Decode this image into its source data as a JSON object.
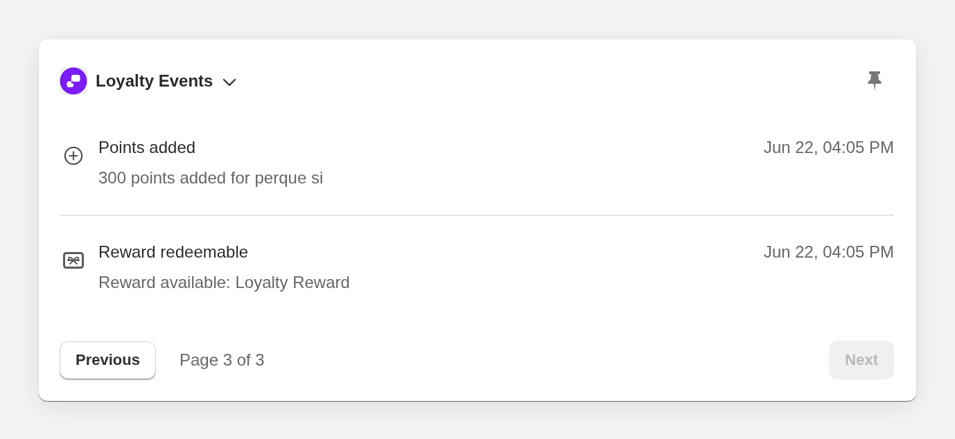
{
  "widget": {
    "title": "Loyalty Events"
  },
  "events": [
    {
      "kind": "points_added",
      "title": "Points added",
      "description": "300 points added for perque si",
      "time": "Jun 22, 04:05 PM"
    },
    {
      "kind": "reward_redeemable",
      "title": "Reward redeemable",
      "description": "Reward available: Loyalty Reward",
      "time": "Jun 22, 04:05 PM"
    }
  ],
  "pagination": {
    "previous": {
      "label": "Previous",
      "disabled": false
    },
    "page_info": "Page 3 of 3",
    "next": {
      "label": "Next",
      "disabled": true
    }
  }
}
